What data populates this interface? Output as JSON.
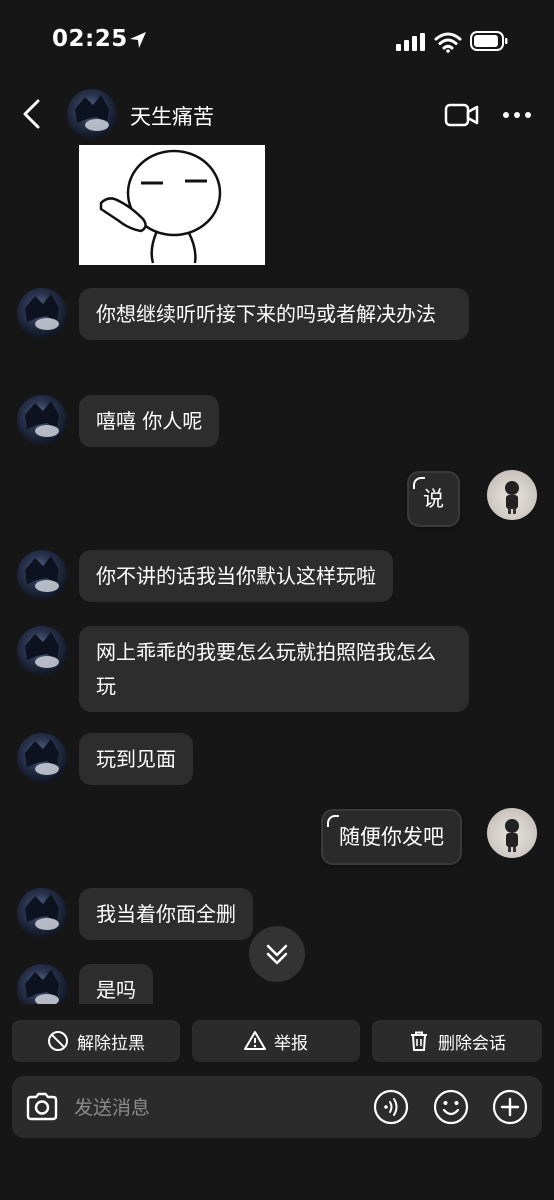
{
  "status_bar": {
    "time": "02:25"
  },
  "header": {
    "title": "天生痛苦"
  },
  "messages": [
    {
      "text": "你想继续听听接下来的吗或者解决办法"
    },
    {
      "text": "嘻嘻 你人呢"
    },
    {
      "text": "说"
    },
    {
      "text": "你不讲的话我当你默认这样玩啦"
    },
    {
      "text": "网上乖乖的我要怎么玩就拍照陪我怎么玩"
    },
    {
      "text": "玩到见面"
    },
    {
      "text": "随便你发吧"
    },
    {
      "text": "我当着你面全删"
    },
    {
      "text": "是吗"
    }
  ],
  "actions": {
    "unblock": "解除拉黑",
    "report": "举报",
    "delete_chat": "删除会话"
  },
  "composer": {
    "placeholder": "发送消息"
  },
  "colors": {
    "background": "#161616",
    "bubble": "#2d2d2d",
    "button": "#2b2b2b"
  }
}
